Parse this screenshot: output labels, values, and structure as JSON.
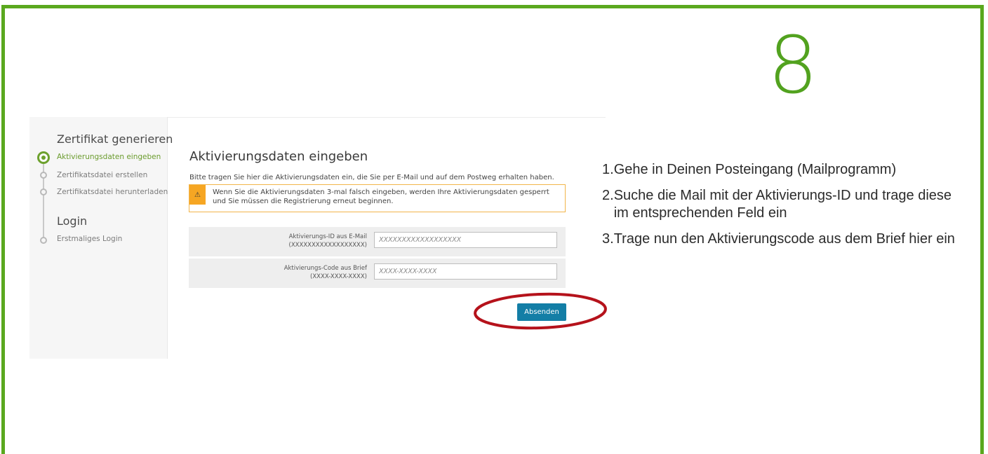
{
  "step_number": "8",
  "sidebar": {
    "section1_title": "Zertifikat generieren",
    "steps": [
      {
        "label": "Aktivierungsdaten eingeben",
        "active": true
      },
      {
        "label": "Zertifikatsdatei erstellen",
        "active": false
      },
      {
        "label": "Zertifikatsdatei herunterladen",
        "active": false
      }
    ],
    "section2_title": "Login",
    "login_steps": [
      {
        "label": "Erstmaliges Login"
      }
    ]
  },
  "main": {
    "title": "Aktivierungsdaten eingeben",
    "intro": "Bitte tragen Sie hier die Aktivierungsdaten ein, die Sie per E-Mail und auf dem Postweg erhalten haben.",
    "warning_icon": "⚠",
    "warning": "Wenn Sie die Aktivierungsdaten 3-mal falsch eingeben, werden Ihre Aktivierungsdaten gesperrt und Sie müssen die Registrierung erneut beginnen.",
    "fields": [
      {
        "label": "Aktivierungs-ID aus E-Mail",
        "format": "(XXXXXXXXXXXXXXXXXX)",
        "placeholder": "XXXXXXXXXXXXXXXXXX",
        "value": ""
      },
      {
        "label": "Aktivierungs-Code aus Brief",
        "format": "(XXXX-XXXX-XXXX)",
        "placeholder": "XXXX-XXXX-XXXX",
        "value": ""
      }
    ],
    "submit_label": "Absenden"
  },
  "instructions": [
    {
      "num": "1.",
      "text": "Gehe in Deinen Posteingang (Mailprogramm)"
    },
    {
      "num": "2.",
      "text": "Suche die Mail mit der Aktivierungs-ID und trage diese im entsprechenden Feld ein"
    },
    {
      "num": "3.",
      "text": "Trage nun den Aktivierungscode aus dem Brief hier ein"
    }
  ],
  "colors": {
    "frame": "#5aa81e",
    "step_number": "#52a21f",
    "active_step": "#6da12e",
    "warning": "#f6a623",
    "button": "#137ea6",
    "highlight": "#b5121b"
  },
  "icons": {
    "active_step": "radio-dot-icon",
    "inactive_step": "circle-icon",
    "warning": "warning-triangle-icon"
  }
}
